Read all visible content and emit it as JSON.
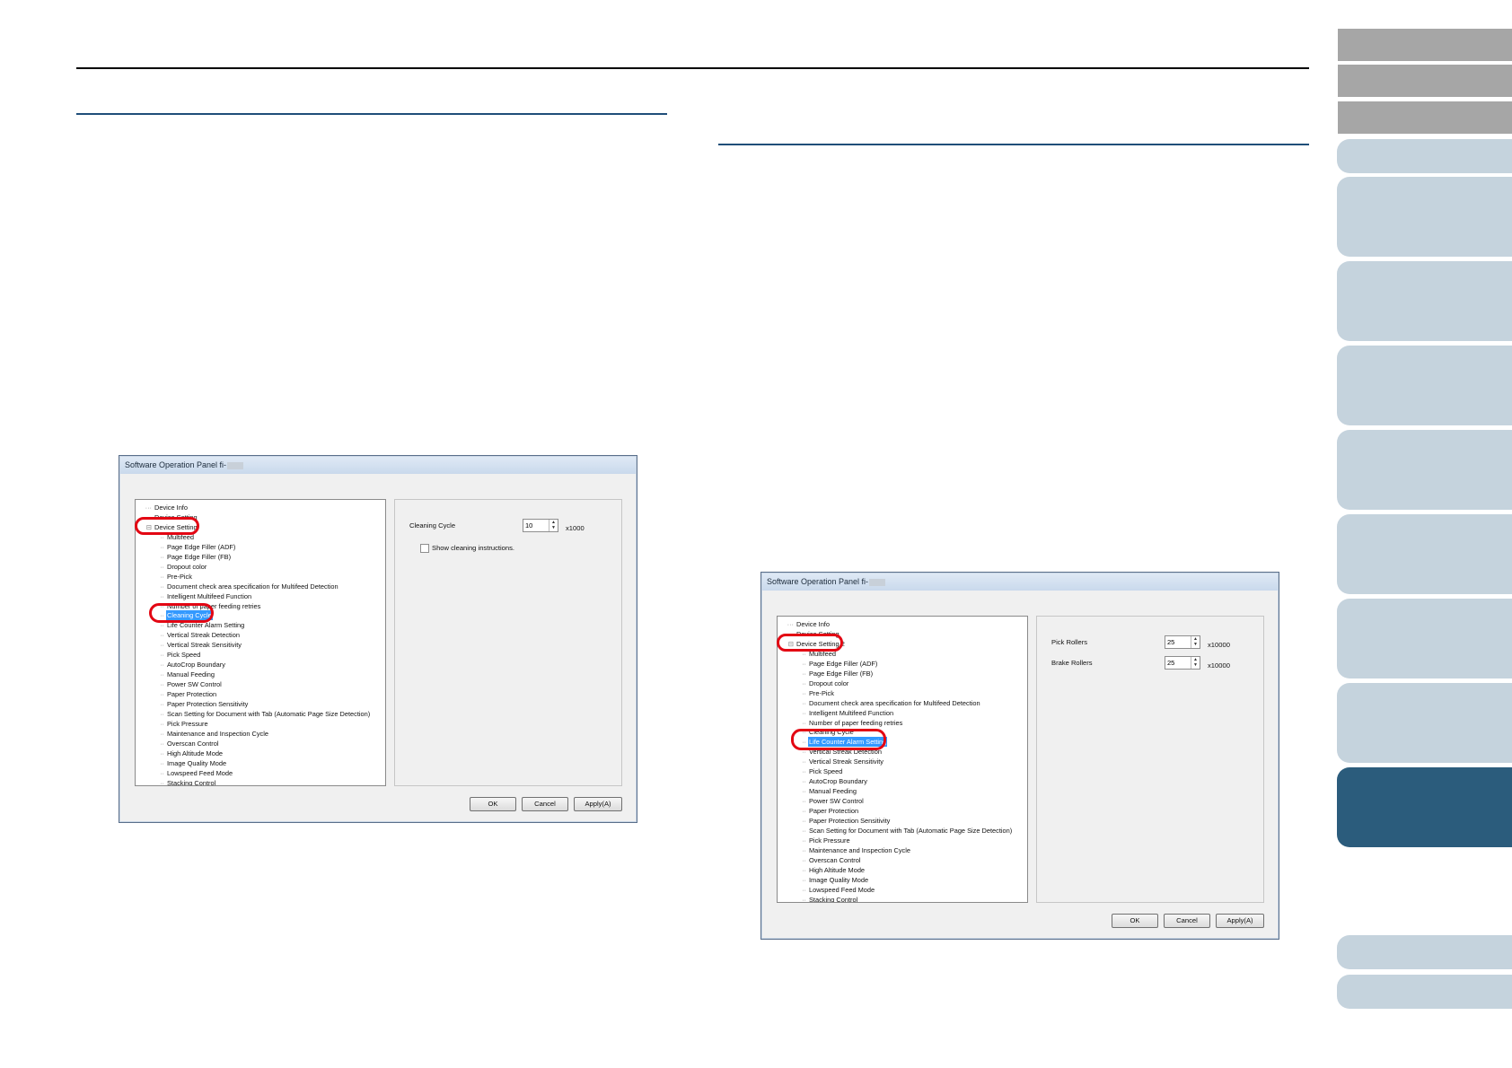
{
  "screen_left": {
    "window_title": "Software Operation Panel fi-",
    "tree_items": [
      {
        "label": "Device Info",
        "prefix": "···"
      },
      {
        "label": "Device Setting",
        "prefix": "···"
      },
      {
        "label": "Device Setting",
        "prefix": "⊟"
      },
      {
        "label": "Multifeed",
        "prefix": "··"
      },
      {
        "label": "Page Edge Filler (ADF)",
        "prefix": "··"
      },
      {
        "label": "Page Edge Filler (FB)",
        "prefix": "··"
      },
      {
        "label": "Dropout color",
        "prefix": "··"
      },
      {
        "label": "Pre-Pick",
        "prefix": "··"
      },
      {
        "label": "Document check area specification for Multifeed Detection",
        "prefix": "··"
      },
      {
        "label": "Intelligent Multifeed Function",
        "prefix": "··"
      },
      {
        "label": "Number of paper feeding retries",
        "prefix": "··"
      },
      {
        "label": "Cleaning Cycle",
        "prefix": "··"
      },
      {
        "label": "Life Counter Alarm Setting",
        "prefix": "··"
      },
      {
        "label": "Vertical Streak Detection",
        "prefix": "··"
      },
      {
        "label": "Vertical Streak Sensitivity",
        "prefix": "··"
      },
      {
        "label": "Pick Speed",
        "prefix": "··"
      },
      {
        "label": "AutoCrop Boundary",
        "prefix": "··"
      },
      {
        "label": "Manual Feeding",
        "prefix": "··"
      },
      {
        "label": "Power SW Control",
        "prefix": "··"
      },
      {
        "label": "Paper Protection",
        "prefix": "··"
      },
      {
        "label": "Paper Protection Sensitivity",
        "prefix": "··"
      },
      {
        "label": "Scan Setting for Document with Tab (Automatic Page Size Detection)",
        "prefix": "··"
      },
      {
        "label": "Pick Pressure",
        "prefix": "··"
      },
      {
        "label": "Maintenance and Inspection Cycle",
        "prefix": "··"
      },
      {
        "label": "Overscan Control",
        "prefix": "··"
      },
      {
        "label": "High Altitude Mode",
        "prefix": "··"
      },
      {
        "label": "Image Quality Mode",
        "prefix": "··"
      },
      {
        "label": "Lowspeed Feed Mode",
        "prefix": "··"
      },
      {
        "label": "Stacking Control",
        "prefix": "··"
      }
    ],
    "selected_index": 11,
    "setting_label": "Cleaning Cycle",
    "setting_value": "10",
    "setting_unit": "x1000",
    "checkbox_label": "Show cleaning instructions.",
    "buttons": {
      "ok": "OK",
      "cancel": "Cancel",
      "apply": "Apply(A)"
    }
  },
  "screen_right": {
    "window_title": "Software Operation Panel fi-",
    "tree_items": [
      {
        "label": "Device Info",
        "prefix": "···"
      },
      {
        "label": "Device Setting",
        "prefix": "···"
      },
      {
        "label": "Device Setting 2",
        "prefix": "⊟"
      },
      {
        "label": "Multifeed",
        "prefix": "··"
      },
      {
        "label": "Page Edge Filler (ADF)",
        "prefix": "··"
      },
      {
        "label": "Page Edge Filler (FB)",
        "prefix": "··"
      },
      {
        "label": "Dropout color",
        "prefix": "··"
      },
      {
        "label": "Pre-Pick",
        "prefix": "··"
      },
      {
        "label": "Document check area specification for Multifeed Detection",
        "prefix": "··"
      },
      {
        "label": "Intelligent Multifeed Function",
        "prefix": "··"
      },
      {
        "label": "Number of paper feeding retries",
        "prefix": "··"
      },
      {
        "label": "Cleaning Cycle",
        "prefix": "··"
      },
      {
        "label": "Life Counter Alarm Setting",
        "prefix": "··"
      },
      {
        "label": "Vertical Streak Detection",
        "prefix": "··"
      },
      {
        "label": "Vertical Streak Sensitivity",
        "prefix": "··"
      },
      {
        "label": "Pick Speed",
        "prefix": "··"
      },
      {
        "label": "AutoCrop Boundary",
        "prefix": "··"
      },
      {
        "label": "Manual Feeding",
        "prefix": "··"
      },
      {
        "label": "Power SW Control",
        "prefix": "··"
      },
      {
        "label": "Paper Protection",
        "prefix": "··"
      },
      {
        "label": "Paper Protection Sensitivity",
        "prefix": "··"
      },
      {
        "label": "Scan Setting for Document with Tab (Automatic Page Size Detection)",
        "prefix": "··"
      },
      {
        "label": "Pick Pressure",
        "prefix": "··"
      },
      {
        "label": "Maintenance and Inspection Cycle",
        "prefix": "··"
      },
      {
        "label": "Overscan Control",
        "prefix": "··"
      },
      {
        "label": "High Altitude Mode",
        "prefix": "··"
      },
      {
        "label": "Image Quality Mode",
        "prefix": "··"
      },
      {
        "label": "Lowspeed Feed Mode",
        "prefix": "··"
      },
      {
        "label": "Stacking Control",
        "prefix": "··"
      }
    ],
    "selected_index": 12,
    "pick_label": "Pick Rollers",
    "pick_value": "25",
    "brake_label": "Brake Rollers",
    "brake_value": "25",
    "unit": "x10000",
    "buttons": {
      "ok": "OK",
      "cancel": "Cancel",
      "apply": "Apply(A)"
    }
  },
  "colors": {
    "accent_tab": "#2b5c7c",
    "tab": "#c5d3dd",
    "gray_tab": "#a6a6a6",
    "highlight": "#e30613",
    "rule": "#1f4e79"
  }
}
